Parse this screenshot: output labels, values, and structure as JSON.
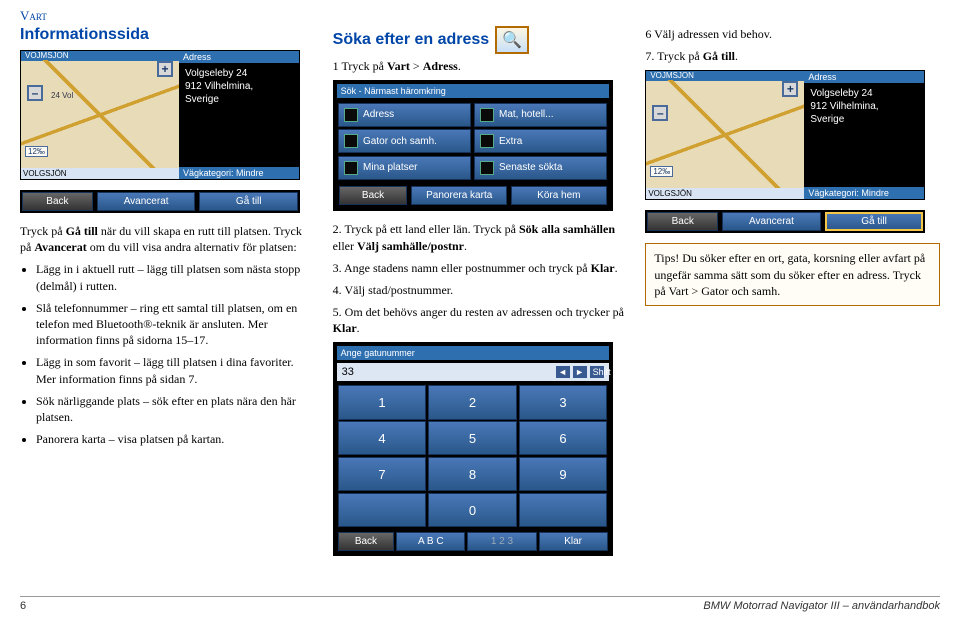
{
  "section_header": "Vart",
  "col1": {
    "heading": "Informationssida",
    "intro": "Tryck på ",
    "intro_bold": "Gå till",
    "intro_tail": " när du vill skapa en rutt till platsen. Tryck på ",
    "intro_bold2": "Avancerat",
    "intro_tail2": " om du vill visa andra alternativ för platsen:",
    "bullets": [
      {
        "b": "Lägg in i aktuell rutt",
        "t": " – lägg till platsen som nästa stopp (delmål) i rutten."
      },
      {
        "b": "Slå telefonnummer",
        "t": " – ring ett samtal till platsen, om en telefon med Bluetooth®-teknik är ansluten. Mer information finns på ",
        "link": "sidorna 15–17",
        "tail": "."
      },
      {
        "b": "Lägg in som favorit",
        "t": " – lägg till platsen i dina favoriter. Mer information finns på ",
        "link": "sidan 7",
        "tail": "."
      },
      {
        "b": "Sök närliggande plats",
        "t": " – sök efter en plats nära den här platsen."
      },
      {
        "b": "Panorera karta",
        "t": " – visa platsen på kartan."
      }
    ]
  },
  "col2": {
    "heading": "Söka efter en adress",
    "step1": "1  Tryck på ",
    "step1_b1": "Vart",
    "step1_mid": " > ",
    "step1_b2": "Adress",
    "step1_end": ".",
    "steps": [
      {
        "n": "2.",
        "t": " Tryck på ett land eller län. Tryck på ",
        "b1": "Sök alla samhällen",
        "mid": " eller ",
        "b2": "Välj samhälle/postnr",
        "end": "."
      },
      {
        "n": "3.",
        "t": " Ange stadens namn eller postnummer och tryck på ",
        "b1": "Klar",
        "end": "."
      },
      {
        "n": "4.",
        "t": " Välj stad/postnummer."
      },
      {
        "n": "5.",
        "t": " Om det behövs anger du resten av adressen och trycker på ",
        "b1": "Klar",
        "end": "."
      }
    ]
  },
  "col3": {
    "step6": "6   Välj adressen vid behov.",
    "step7": "7.  Tryck på ",
    "step7_b": "Gå till",
    "step7_end": ".",
    "tip_label": "Tips!",
    "tip_body": " Du söker efter en ort, gata, korsning eller avfart på ungefär samma sätt som du söker efter en adress. Tryck på ",
    "tip_b1": "Vart",
    "tip_mid": " > ",
    "tip_b2": "Gator och samh.",
    "tip_end": ""
  },
  "gps": {
    "adress_label": "Adress",
    "map_top": "VOJMSJON",
    "addr_line1": "Volgseleby 24",
    "addr_line2": "912 Vilhelmina,",
    "addr_line3": "Sverige",
    "cat_label": "Vägkategori: Mindre",
    "scale": "12‰",
    "street": "VOLGSJÖN",
    "street_left": "24 Vol",
    "btn_back": "Back",
    "btn_adv": "Avancerat",
    "btn_go": "Gå till",
    "minus": "–",
    "plus": "+"
  },
  "search": {
    "top": "Sök - Närmast häromkring",
    "cells": [
      "Adress",
      "Mat, hotell...",
      "Gator och samh.",
      "Extra",
      "Mina platser",
      "Senaste sökta"
    ],
    "btn_back": "Back",
    "btn_pan": "Panorera karta",
    "btn_home": "Köra hem"
  },
  "keypad": {
    "hdr": "Ange gatunummer",
    "entry_val": "33",
    "keys": [
      "1",
      "2",
      "3",
      "4",
      "5",
      "6",
      "7",
      "8",
      "9",
      " ",
      "0",
      " "
    ],
    "btn_back": "Back",
    "btn_abc": "A B C",
    "btn_123": "1 2 3",
    "btn_done": "Klar"
  },
  "footer": {
    "page": "6",
    "book": "BMW Motorrad Navigator III – användarhandbok"
  }
}
